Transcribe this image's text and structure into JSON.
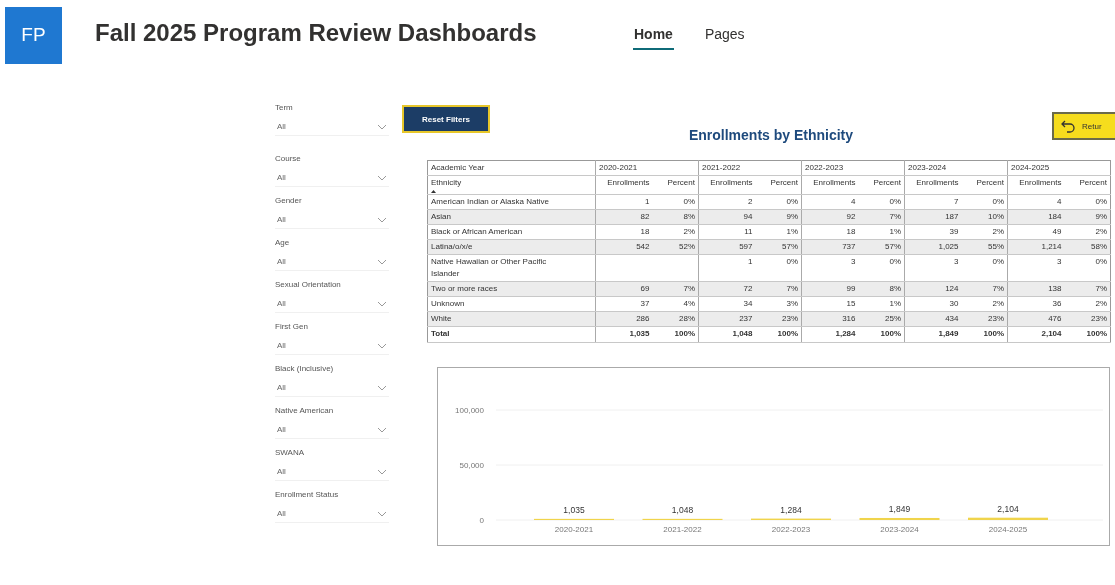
{
  "header": {
    "logo": "FP",
    "title": "Fall 2025 Program Review Dashboards"
  },
  "tabs": [
    {
      "label": "Home",
      "selected": true
    },
    {
      "label": "Pages",
      "selected": false
    }
  ],
  "filters": [
    {
      "label": "Term",
      "value": "All"
    },
    {
      "label": "Course",
      "value": "All"
    },
    {
      "label": "Gender",
      "value": "All"
    },
    {
      "label": "Age",
      "value": "All"
    },
    {
      "label": "Sexual Orientation",
      "value": "All"
    },
    {
      "label": "First Gen",
      "value": "All"
    },
    {
      "label": "Black (Inclusive)",
      "value": "All"
    },
    {
      "label": "Native American",
      "value": "All"
    },
    {
      "label": "SWANA",
      "value": "All"
    },
    {
      "label": "Enrollment Status",
      "value": "All"
    }
  ],
  "reset_button": "Reset Filters",
  "report_title": "Enrollments by Ethnicity",
  "return_button": "Retur",
  "table": {
    "year_header": "Academic Year",
    "row_header": "Ethnicity",
    "years": [
      {
        "label": "2020-2021",
        "measures": [
          "Enrollments",
          "Percent"
        ]
      },
      {
        "label": "2021-2022",
        "measures": [
          "Enrollments",
          "Percent"
        ]
      },
      {
        "label": "2022-2023",
        "measures": [
          "Enrollments",
          "Percent"
        ]
      },
      {
        "label": "2023-2024",
        "measures": [
          "Enrollments",
          "Percent"
        ]
      },
      {
        "label": "2024-2025",
        "measures": [
          "Enrollments",
          "Percent"
        ]
      }
    ],
    "rows": [
      {
        "ethnicity": "American Indian or Alaska Native",
        "cells": [
          "1",
          "0%",
          "2",
          "0%",
          "4",
          "0%",
          "7",
          "0%",
          "4",
          "0%"
        ]
      },
      {
        "ethnicity": "Asian",
        "cells": [
          "82",
          "8%",
          "94",
          "9%",
          "92",
          "7%",
          "187",
          "10%",
          "184",
          "9%"
        ]
      },
      {
        "ethnicity": "Black or African American",
        "cells": [
          "18",
          "2%",
          "11",
          "1%",
          "18",
          "1%",
          "39",
          "2%",
          "49",
          "2%"
        ]
      },
      {
        "ethnicity": "Latina/o/x/e",
        "cells": [
          "542",
          "52%",
          "597",
          "57%",
          "737",
          "57%",
          "1,025",
          "55%",
          "1,214",
          "58%"
        ]
      },
      {
        "ethnicity": "Native Hawaiian or Other Pacific Islander",
        "cells": [
          null,
          null,
          "1",
          "0%",
          "3",
          "0%",
          "3",
          "0%",
          "3",
          "0%"
        ]
      },
      {
        "ethnicity": "Two or more races",
        "cells": [
          "69",
          "7%",
          "72",
          "7%",
          "99",
          "8%",
          "124",
          "7%",
          "138",
          "7%"
        ]
      },
      {
        "ethnicity": "Unknown",
        "cells": [
          "37",
          "4%",
          "34",
          "3%",
          "15",
          "1%",
          "30",
          "2%",
          "36",
          "2%"
        ]
      },
      {
        "ethnicity": "White",
        "cells": [
          "286",
          "28%",
          "237",
          "23%",
          "316",
          "25%",
          "434",
          "23%",
          "476",
          "23%"
        ]
      }
    ],
    "total": {
      "label": "Total",
      "cells": [
        "1,035",
        "100%",
        "1,048",
        "100%",
        "1,284",
        "100%",
        "1,849",
        "100%",
        "2,104",
        "100%"
      ]
    }
  },
  "chart": {
    "chart_data": {
      "type": "bar",
      "categories": [
        "2020-2021",
        "2021-2022",
        "2022-2023",
        "2023-2024",
        "2024-2025"
      ],
      "values": [
        1035,
        1048,
        1284,
        1849,
        2104
      ],
      "value_labels": [
        "1,035",
        "1,048",
        "1,284",
        "1,849",
        "2,104"
      ],
      "ylim": [
        0,
        100000
      ],
      "yticks": [
        {
          "value": 0,
          "label": "0"
        },
        {
          "value": 50000,
          "label": "50,000"
        },
        {
          "value": 100000,
          "label": "100,000"
        }
      ]
    }
  }
}
